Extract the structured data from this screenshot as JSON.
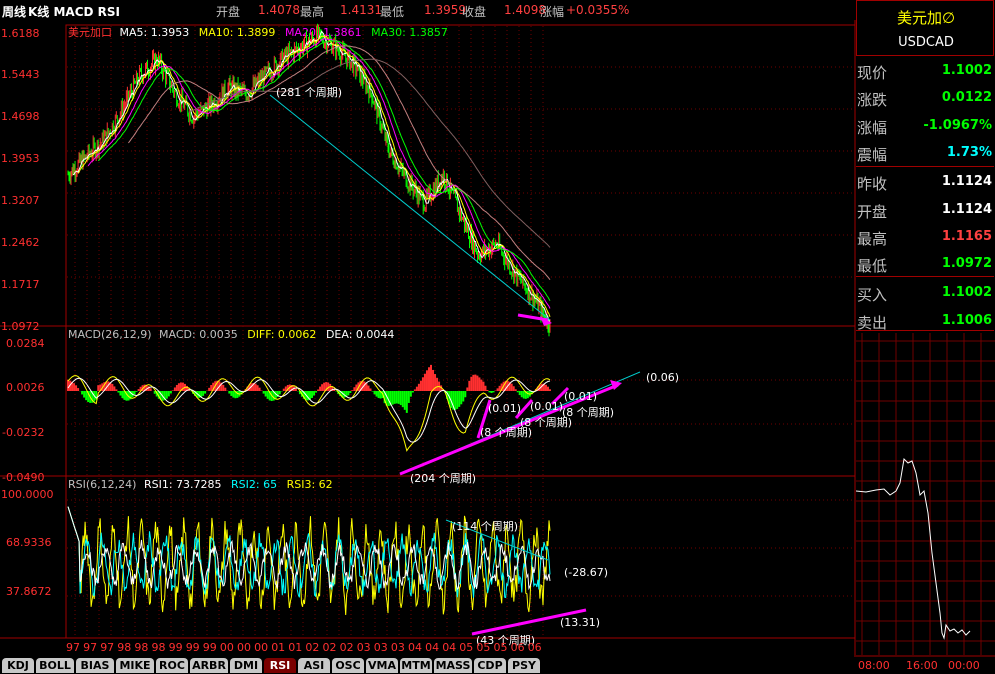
{
  "header": {
    "period": "周线",
    "chart_types": "K线 MACD RSI",
    "open_label": "开盘",
    "open": "1.4078",
    "high_label": "最高",
    "high": "1.4131",
    "low_label": "最低",
    "low": "1.3959",
    "close_label": "收盘",
    "close": "1.4098",
    "change_label": "涨幅",
    "change": "+0.0355%"
  },
  "kline": {
    "symbol": "美元加口",
    "ma5": "MA5: 1.3953",
    "ma10": "MA10: 1.3899",
    "ma20": "MA20: 1.3861",
    "ma30": "MA30: 1.3857",
    "yticks": [
      "1.6188",
      "1.5443",
      "1.4698",
      "1.3953",
      "1.3207",
      "1.2462",
      "1.1717",
      "1.0972"
    ],
    "annotation": "(281 个周期)"
  },
  "macd": {
    "title": "MACD(26,12,9)",
    "macd": "MACD: 0.0035",
    "diff": "DIFF: 0.0062",
    "dea": "DEA: 0.0044",
    "yticks": [
      "0.0284",
      "0.0026",
      "-0.0232",
      "-0.0490"
    ],
    "annotations": [
      "(0.06)",
      "(0.01)",
      "(0.01)",
      "(0.01)",
      "(8 个周期)",
      "(8 个周期)",
      "(8 个周期)",
      "(204 个周期)"
    ]
  },
  "rsi": {
    "title": "RSI(6,12,24)",
    "rsi1": "RSI1: 73.7285",
    "rsi2": "RSI2: 65",
    "rsi3": "RSI3: 62",
    "yticks": [
      "100.0000",
      "68.9336",
      "37.8672"
    ],
    "annotations": [
      "(114 个周期)",
      "(-28.67)",
      "(13.31)",
      "(43 个周期)"
    ]
  },
  "xaxis": [
    "97",
    "97",
    "97",
    "98",
    "98",
    "98",
    "99",
    "99",
    "99",
    "00",
    "00",
    "00",
    "01",
    "01",
    "02",
    "02",
    "02",
    "03",
    "03",
    "03",
    "04",
    "04",
    "04",
    "05",
    "05",
    "05",
    "06",
    "06"
  ],
  "side": {
    "name": "美元加∅",
    "code": "USDCAD",
    "rows": [
      {
        "label": "现价",
        "value": "1.1002",
        "color": "#00ff00"
      },
      {
        "label": "涨跌",
        "value": "0.0122",
        "color": "#00ff00"
      },
      {
        "label": "涨幅",
        "value": "-1.0967%",
        "color": "#00ff00"
      },
      {
        "label": "震幅",
        "value": "1.73%",
        "color": "#00ffff"
      },
      {
        "label": "昨收",
        "value": "1.1124",
        "color": "#ffffff"
      },
      {
        "label": "开盘",
        "value": "1.1124",
        "color": "#ffffff"
      },
      {
        "label": "最高",
        "value": "1.1165",
        "color": "#ff4040"
      },
      {
        "label": "最低",
        "value": "1.0972",
        "color": "#00ff00"
      },
      {
        "label": "买入",
        "value": "1.1002",
        "color": "#00ff00"
      },
      {
        "label": "卖出",
        "value": "1.1006",
        "color": "#00ff00"
      }
    ],
    "times": [
      "08:00",
      "16:00",
      "00:00"
    ]
  },
  "tabs": [
    "KDJ",
    "BOLL",
    "BIAS",
    "MIKE",
    "ROC",
    "ARBR",
    "DMI",
    "RSI",
    "ASI",
    "OSC",
    "VMA",
    "MTM",
    "MASS",
    "CDP",
    "PSY"
  ],
  "active_tab": "RSI",
  "colors": {
    "up": "#ff3030",
    "down": "#00ff00",
    "grid": "#a00000",
    "ma5": "#ffffff",
    "ma10": "#ffff00",
    "ma20": "#ff00ff",
    "ma30": "#00ff00",
    "magenta": "#ff00ff",
    "cyan": "#00ffff"
  },
  "chart_data": [
    {
      "type": "candlestick",
      "title": "美元加口 周线",
      "ylim": [
        1.0972,
        1.6188
      ],
      "close_trend": [
        1.36,
        1.39,
        1.42,
        1.47,
        1.53,
        1.56,
        1.5,
        1.46,
        1.48,
        1.51,
        1.5,
        1.53,
        1.56,
        1.58,
        1.6,
        1.58,
        1.55,
        1.5,
        1.4,
        1.35,
        1.31,
        1.36,
        1.29,
        1.22,
        1.24,
        1.19,
        1.15,
        1.1
      ]
    },
    {
      "type": "line",
      "title": "MACD(26,12,9)",
      "ylim": [
        -0.049,
        0.0284
      ]
    },
    {
      "type": "line",
      "title": "RSI(6,12,24)",
      "ylim": [
        10,
        100
      ]
    }
  ]
}
